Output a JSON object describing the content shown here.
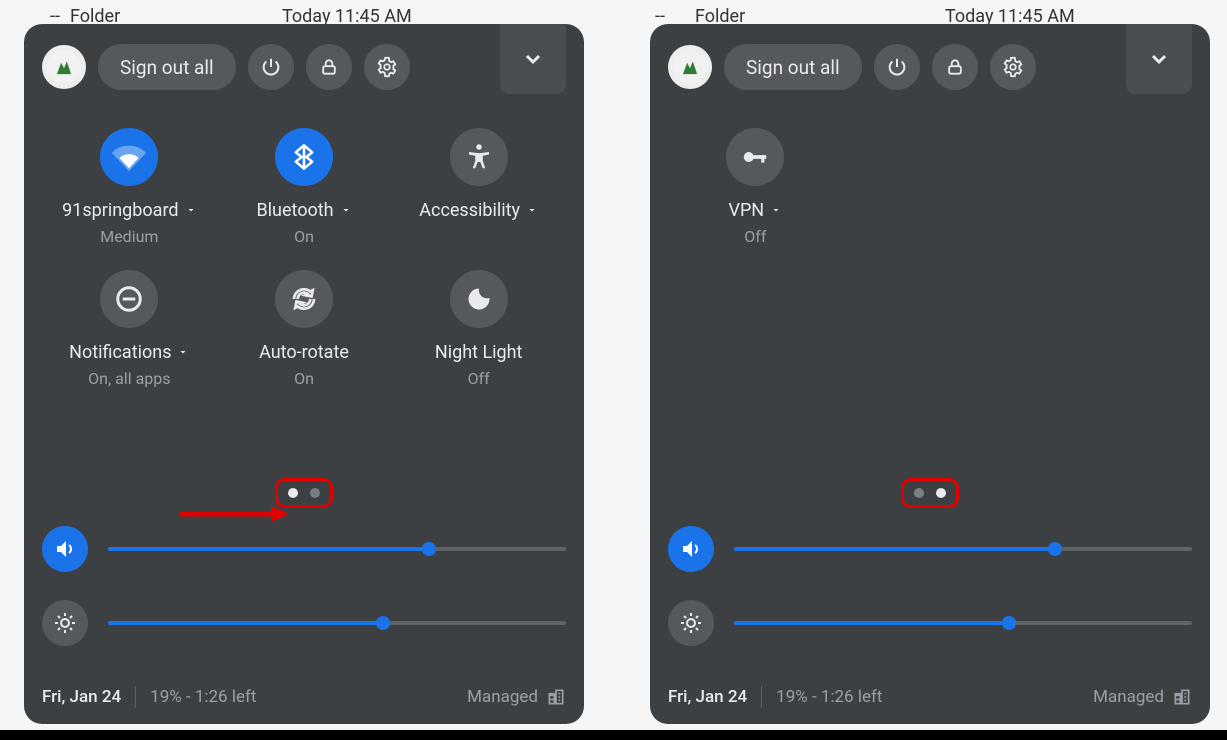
{
  "top": {
    "dash": "--",
    "folder": "Folder",
    "time": "Today 11:45 AM"
  },
  "header": {
    "sign_out": "Sign out all"
  },
  "panel1": {
    "tiles": {
      "wifi": {
        "label": "91springboard",
        "sub": "Medium"
      },
      "bluetooth": {
        "label": "Bluetooth",
        "sub": "On"
      },
      "accessibility": {
        "label": "Accessibility",
        "sub": ""
      },
      "notifications": {
        "label": "Notifications",
        "sub": "On, all apps"
      },
      "autorotate": {
        "label": "Auto-rotate",
        "sub": "On"
      },
      "nightlight": {
        "label": "Night Light",
        "sub": "Off"
      }
    }
  },
  "panel2": {
    "tiles": {
      "vpn": {
        "label": "VPN",
        "sub": "Off"
      }
    }
  },
  "sliders": {
    "volume_pct": 70,
    "brightness_pct": 60
  },
  "footer": {
    "date": "Fri, Jan 24",
    "battery": "19% - 1:26 left",
    "managed": "Managed"
  }
}
